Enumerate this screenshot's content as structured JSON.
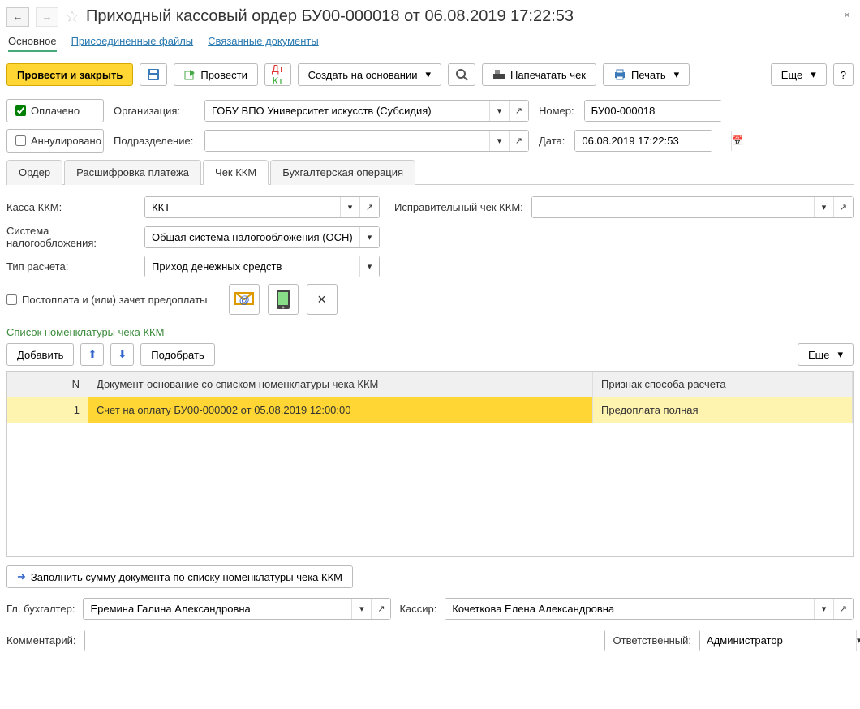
{
  "title": "Приходный кассовый ордер БУ00-000018 от 06.08.2019 17:22:53",
  "nav": {
    "main": "Основное",
    "files": "Присоединенные файлы",
    "related": "Связанные документы"
  },
  "toolbar": {
    "postAndClose": "Провести и закрыть",
    "post": "Провести",
    "createBased": "Создать на основании",
    "printReceipt": "Напечатать чек",
    "print": "Печать",
    "more": "Еще"
  },
  "checks": {
    "paid": "Оплачено",
    "cancelled": "Аннулировано"
  },
  "labels": {
    "org": "Организация:",
    "subdiv": "Подразделение:",
    "number": "Номер:",
    "date": "Дата:"
  },
  "values": {
    "org": "ГОБУ ВПО Университет искусств (Субсидия)",
    "number": "БУ00-000018",
    "date": "06.08.2019 17:22:53"
  },
  "tabs": {
    "order": "Ордер",
    "decode": "Расшифровка платежа",
    "kkm": "Чек ККМ",
    "acc": "Бухгалтерская операция"
  },
  "kkm": {
    "kassaLabel": "Касса ККМ:",
    "kassa": "ККТ",
    "correctLabel": "Исправительный чек ККМ:",
    "taxLabel": "Система налогообложения:",
    "tax": "Общая система налогообложения (ОСН)",
    "typeLabel": "Тип расчета:",
    "type": "Приход денежных средств",
    "postpay": "Постоплата и (или) зачет предоплаты"
  },
  "section": "Список номенклатуры чека ККМ",
  "tblBar": {
    "add": "Добавить",
    "select": "Подобрать",
    "more": "Еще"
  },
  "columns": {
    "n": "N",
    "doc": "Документ-основание со списком номенклатуры чека ККМ",
    "p": "Признак способа расчета"
  },
  "rows": [
    {
      "n": "1",
      "doc": "Счет на оплату БУ00-000002 от 05.08.2019 12:00:00",
      "p": "Предоплата полная"
    }
  ],
  "fillBtn": "Заполнить сумму документа по списку номенклатуры чека ККМ",
  "footer": {
    "accountantLabel": "Гл. бухгалтер:",
    "accountant": "Еремина Галина Александровна",
    "cashierLabel": "Кассир:",
    "cashier": "Кочеткова Елена Александровна",
    "commentLabel": "Комментарий:",
    "responsibleLabel": "Ответственный:",
    "responsible": "Администратор"
  }
}
